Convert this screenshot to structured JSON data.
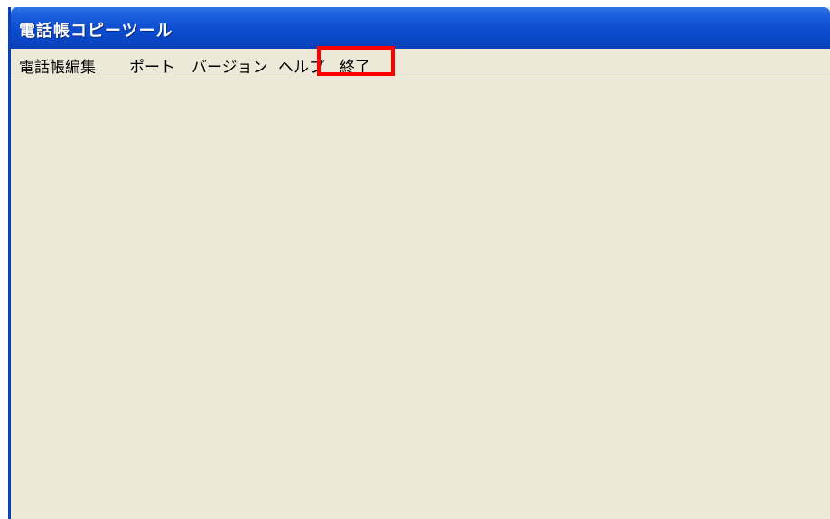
{
  "window": {
    "title": "電話帳コピーツール"
  },
  "menubar": {
    "items": [
      {
        "label": "電話帳編集"
      },
      {
        "label": "ポート"
      },
      {
        "label": "バージョン"
      },
      {
        "label": "ヘルプ"
      },
      {
        "label": "終了"
      }
    ]
  },
  "annotation": {
    "highlight_color": "#ff0000",
    "highlighted_item": "終了"
  },
  "colors": {
    "titlebar": "#0b4ccf",
    "window_background": "#ece9d8"
  }
}
